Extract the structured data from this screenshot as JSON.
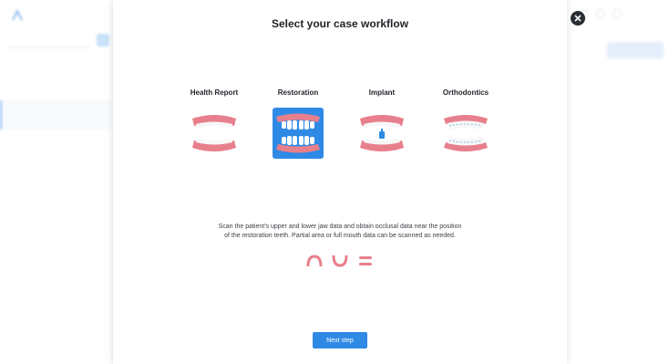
{
  "modal": {
    "title": "Select your case workflow",
    "workflows": [
      {
        "id": "health-report",
        "label": "Health Report",
        "selected": false
      },
      {
        "id": "restoration",
        "label": "Restoration",
        "selected": true
      },
      {
        "id": "implant",
        "label": "Implant",
        "selected": false
      },
      {
        "id": "orthodontics",
        "label": "Orthodontics",
        "selected": false
      }
    ],
    "description": "Scan the patient's upper and lower jaw data and obtain occlusal data near the position of the restoration teeth. Partial area or full mouth data can be scanned as needed.",
    "scan_icons": [
      "upper-jaw-icon",
      "lower-jaw-icon",
      "occlusion-icon"
    ],
    "next_label": "Next step"
  },
  "colors": {
    "accent": "#2f8ae5",
    "gum": "#e87f8c",
    "tooth": "#ffffff"
  }
}
